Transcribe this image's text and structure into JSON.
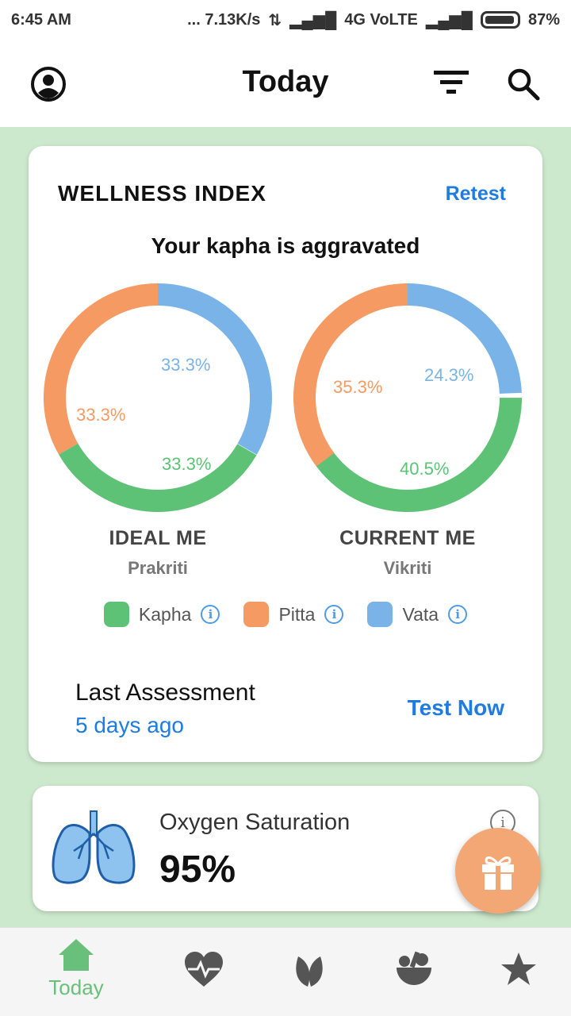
{
  "status_bar": {
    "time": "6:45 AM",
    "network": "... 7.13K/s",
    "signal_text": "4G VoLTE",
    "battery": "87%"
  },
  "header": {
    "title": "Today"
  },
  "wellness": {
    "title": "WELLNESS INDEX",
    "retest": "Retest",
    "subtitle": "Your kapha is aggravated",
    "ideal": {
      "label": "IDEAL ME",
      "sublabel": "Prakriti",
      "kapha": "33.3%",
      "pitta": "33.3%",
      "vata": "33.3%"
    },
    "current": {
      "label": "CURRENT ME",
      "sublabel": "Vikriti",
      "kapha": "40.5%",
      "pitta": "35.3%",
      "vata": "24.3%"
    },
    "legend": {
      "kapha": "Kapha",
      "pitta": "Pitta",
      "vata": "Vata"
    },
    "last_assessment_label": "Last Assessment",
    "last_assessment_value": "5 days ago",
    "test_now": "Test Now"
  },
  "oxygen": {
    "label": "Oxygen Saturation",
    "value": "95%"
  },
  "nav": {
    "today": "Today"
  },
  "colors": {
    "kapha": "#5dc276",
    "pitta": "#f59a63",
    "vata": "#7ab3e8",
    "accent": "#1e7be0",
    "nav_active": "#69c07a",
    "background": "#cde9cd"
  }
}
